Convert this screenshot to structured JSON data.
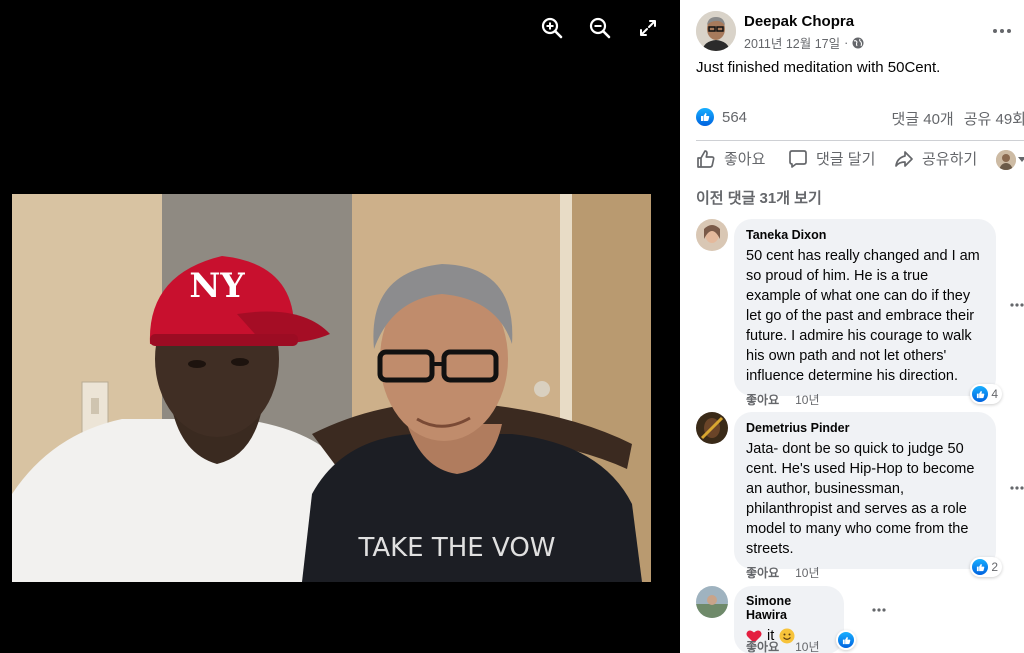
{
  "viewer": {
    "zoom_in_icon": "zoom-in-icon",
    "zoom_out_icon": "zoom-out-icon",
    "fullscreen_icon": "fullscreen-icon",
    "photo_shirt_text": "TAKE THE VOW"
  },
  "post": {
    "author": "Deepak Chopra",
    "date": "2011년 12월 17일",
    "separator": "·",
    "text": "Just finished meditation with 50Cent.",
    "like_count": "564",
    "comment_count": "댓글 40개",
    "share_count": "공유 49회"
  },
  "actions": {
    "like": "좋아요",
    "comment": "댓글 달기",
    "share": "공유하기"
  },
  "view_previous": "이전 댓글 31개 보기",
  "comments": [
    {
      "name": "Taneka Dixon",
      "lines": [
        "50 cent has really changed and I am",
        "so proud of him. He is a true",
        "example of what one can do if they",
        "let go of the past and embrace their",
        "future. I admire his courage to walk",
        "his own path and not let others'",
        "influence determine his direction."
      ],
      "reactions": "4",
      "like_label": "좋아요",
      "time": "10년"
    },
    {
      "name": "Demetrius Pinder",
      "lines": [
        "Jata- dont be so quick to judge 50",
        "cent. He's used Hip-Hop to become",
        "an author, businessman,",
        "philanthropist and serves as a role",
        "model to many who come from the",
        "streets."
      ],
      "reactions": "2",
      "like_label": "좋아요",
      "time": "10년"
    },
    {
      "name": "Simone Hawira",
      "text": "it",
      "like_label": "좋아요",
      "time": "10년"
    }
  ],
  "colors": {
    "accent": "#0866ff",
    "secondary_text": "#65676b",
    "bubble": "#f0f2f5",
    "cap_red": "#c8102e"
  }
}
